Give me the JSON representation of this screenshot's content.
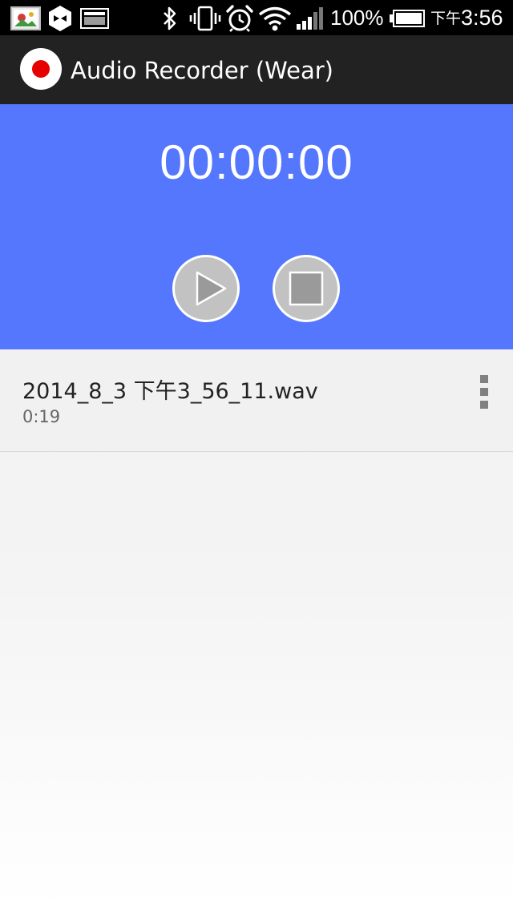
{
  "status_bar": {
    "battery_percent": "100%",
    "time_prefix": "下午",
    "time": "3:56",
    "icons": [
      "gallery-notification-icon",
      "hexagon-app-notification-icon",
      "screenshot-notification-icon",
      "bluetooth-icon",
      "vibrate-icon",
      "alarm-icon",
      "wifi-icon",
      "signal-icon",
      "battery-icon"
    ]
  },
  "action_bar": {
    "title": "Audio Recorder (Wear)",
    "logo_icon": "record-icon",
    "logo_dot_color": "#e60000"
  },
  "recorder": {
    "timer": "00:00:00",
    "background_color": "#5477fd",
    "play_icon": "play-icon",
    "stop_icon": "stop-icon"
  },
  "recordings": [
    {
      "name": "2014_8_3 下午3_56_11.wav",
      "duration": "0:19",
      "menu_icon": "overflow-menu-icon"
    }
  ]
}
